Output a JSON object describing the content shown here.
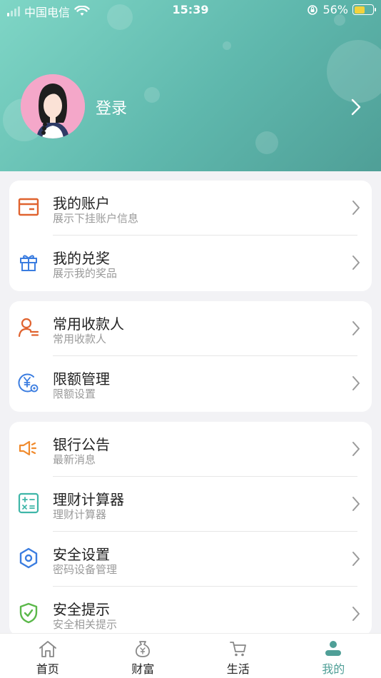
{
  "status_bar": {
    "carrier": "中国电信",
    "time": "15:39",
    "battery": "56%"
  },
  "profile": {
    "login_label": "登录"
  },
  "groups": [
    [
      {
        "title": "我的账户",
        "subtitle": "展示下挂账户信息",
        "icon": "wallet-icon",
        "color": "#e0632f"
      },
      {
        "title": "我的兑奖",
        "subtitle": "展示我的奖品",
        "icon": "gift-icon",
        "color": "#3b7de0"
      }
    ],
    [
      {
        "title": "常用收款人",
        "subtitle": "常用收款人",
        "icon": "payee-icon",
        "color": "#e0632f"
      },
      {
        "title": "限额管理",
        "subtitle": "限额设置",
        "icon": "limit-icon",
        "color": "#3b7de0"
      }
    ],
    [
      {
        "title": "银行公告",
        "subtitle": "最新消息",
        "icon": "announcement-icon",
        "color": "#f08a2c"
      },
      {
        "title": "理财计算器",
        "subtitle": "理财计算器",
        "icon": "calculator-icon",
        "color": "#3fb6a8"
      },
      {
        "title": "安全设置",
        "subtitle": "密码设备管理",
        "icon": "security-settings-icon",
        "color": "#3b7de0"
      },
      {
        "title": "安全提示",
        "subtitle": "安全相关提示",
        "icon": "shield-check-icon",
        "color": "#5bb84a"
      }
    ]
  ],
  "tabs": [
    {
      "label": "首页",
      "icon": "home-icon"
    },
    {
      "label": "财富",
      "icon": "money-bag-icon"
    },
    {
      "label": "生活",
      "icon": "cart-icon"
    },
    {
      "label": "我的",
      "icon": "user-icon"
    }
  ],
  "colors": {
    "accent": "#4f9f97",
    "header_start": "#7fd6c6",
    "header_end": "#4f9f97"
  }
}
